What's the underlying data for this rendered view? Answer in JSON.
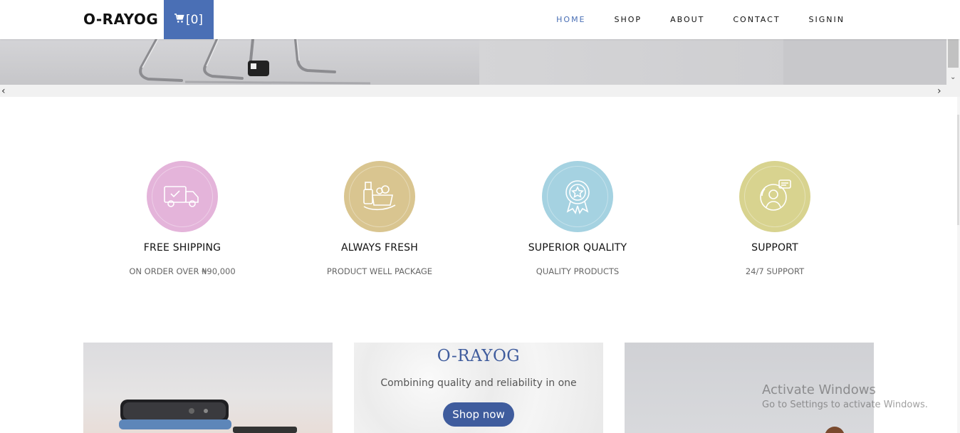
{
  "navbar": {
    "brand": "O-RAYOG",
    "cart_count": "[0]",
    "links": [
      "HOME",
      "SHOP",
      "ABOUT",
      "CONTACT",
      "SIGNIN"
    ],
    "active": "HOME",
    "accent_color": "#4a6fb5"
  },
  "hero": {
    "left_arrow": "‹",
    "right_arrow": "›"
  },
  "features": [
    {
      "icon": "delivery-truck-icon",
      "color": "#e4b4da",
      "title": "FREE SHIPPING",
      "subtitle": "ON ORDER OVER ₦90,000"
    },
    {
      "icon": "grocery-bag-icon",
      "color": "#d9c590",
      "title": "ALWAYS FRESH",
      "subtitle": "PRODUCT WELL PACKAGE"
    },
    {
      "icon": "quality-badge-icon",
      "color": "#a5d2e1",
      "title": "SUPERIOR QUALITY",
      "subtitle": "QUALITY PRODUCTS"
    },
    {
      "icon": "support-agent-icon",
      "color": "#d8d38f",
      "title": "SUPPORT",
      "subtitle": "24/7 SUPPORT"
    }
  ],
  "promo": {
    "title": "O-RAYOG",
    "text": "Combining quality and reliability in one",
    "button": "Shop now"
  },
  "watermark": {
    "line1": "Activate Windows",
    "line2": "Go to Settings to activate Windows."
  }
}
